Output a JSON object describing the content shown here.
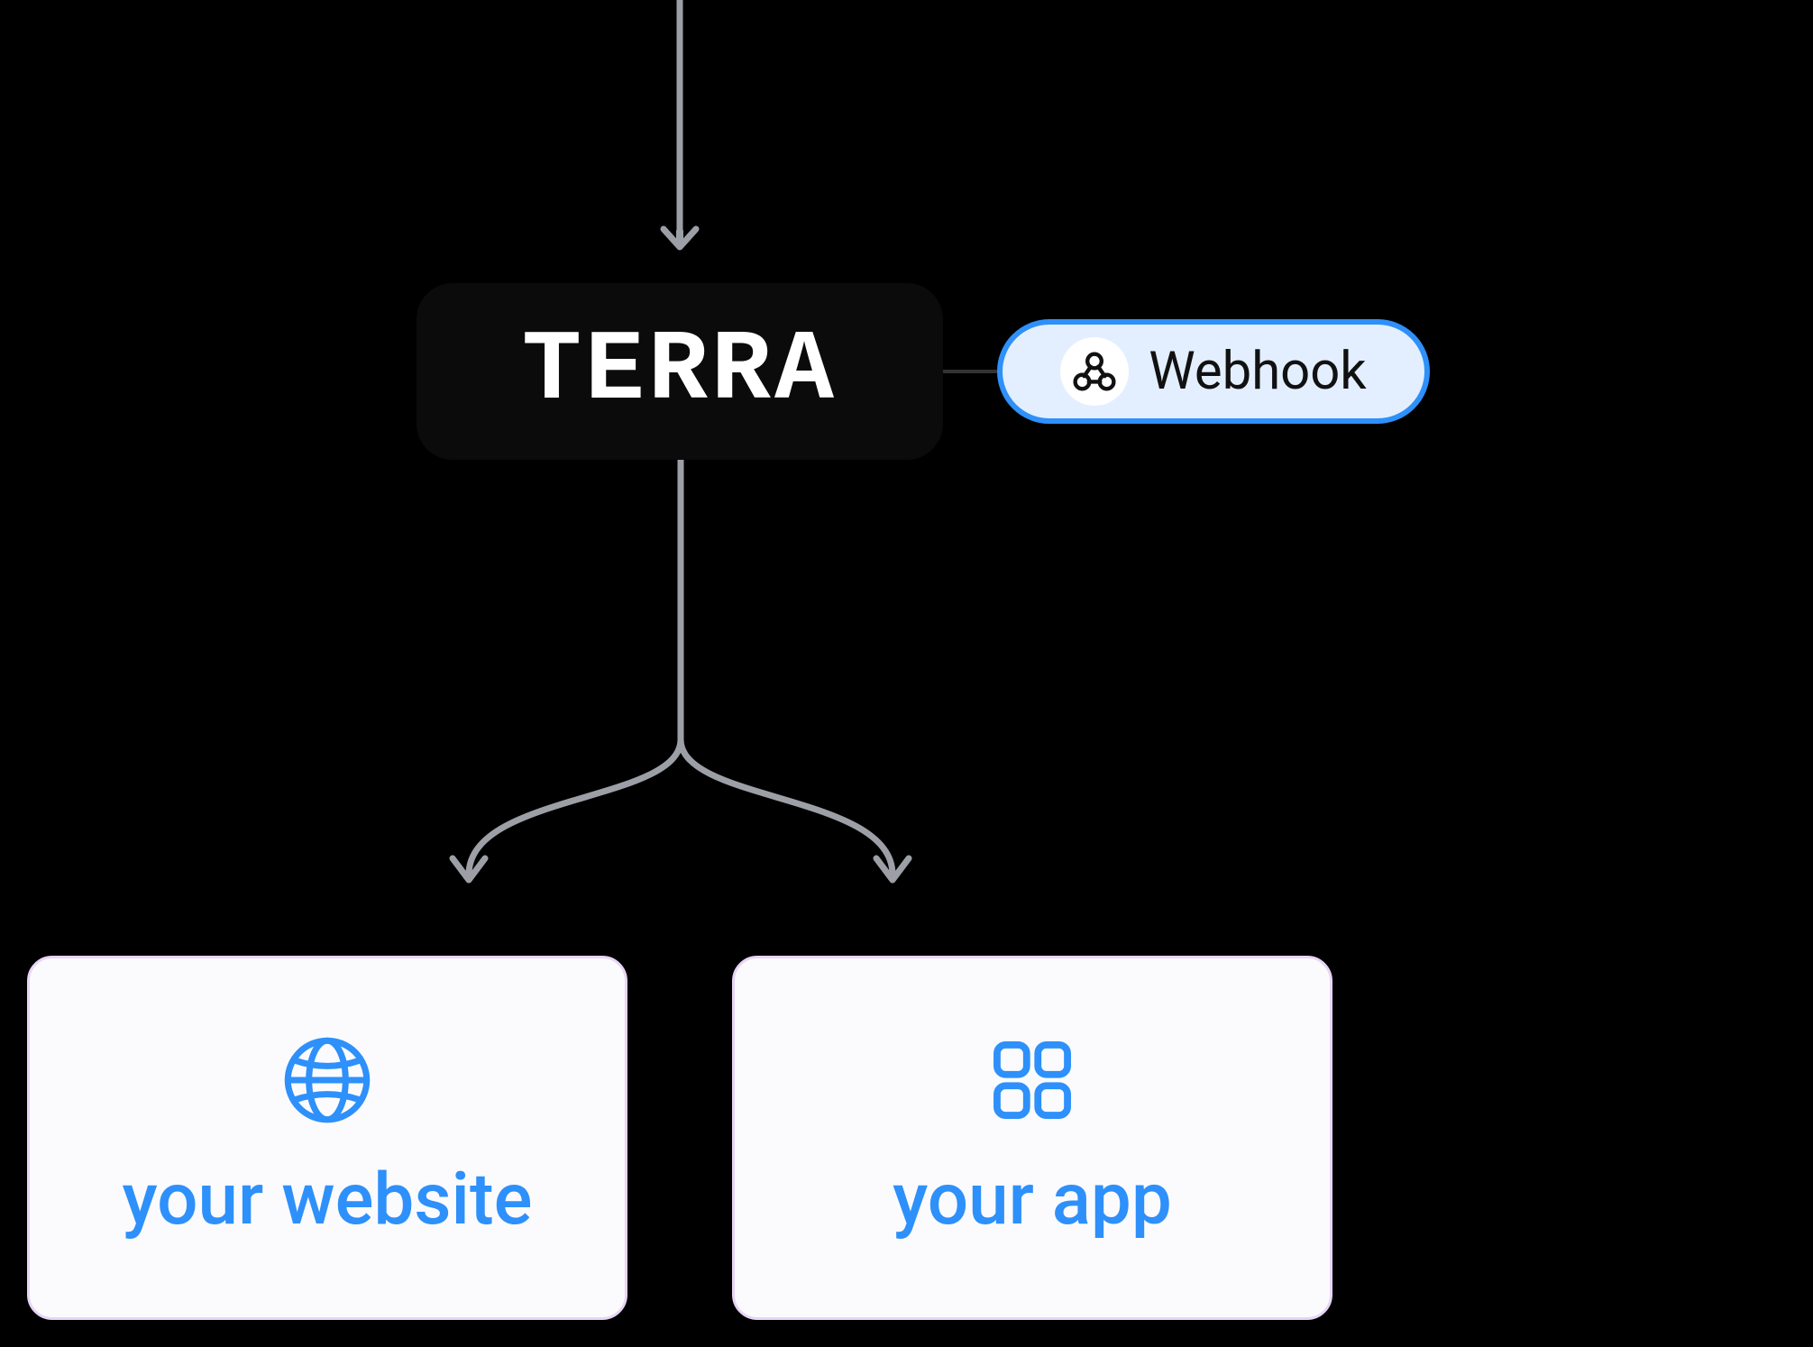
{
  "nodes": {
    "terra": {
      "label": "TERRA"
    },
    "webhook": {
      "label": "Webhook",
      "icon": "webhook-icon"
    },
    "website": {
      "label": "your website",
      "icon": "globe-icon"
    },
    "app": {
      "label": "your app",
      "icon": "apps-grid-icon"
    }
  },
  "colors": {
    "accent_blue": "#2e90fa",
    "webhook_bg": "#e3efff",
    "card_bg": "#fbfbfd",
    "card_border": "#e8d5f5",
    "arrow": "#9ca0a6"
  }
}
